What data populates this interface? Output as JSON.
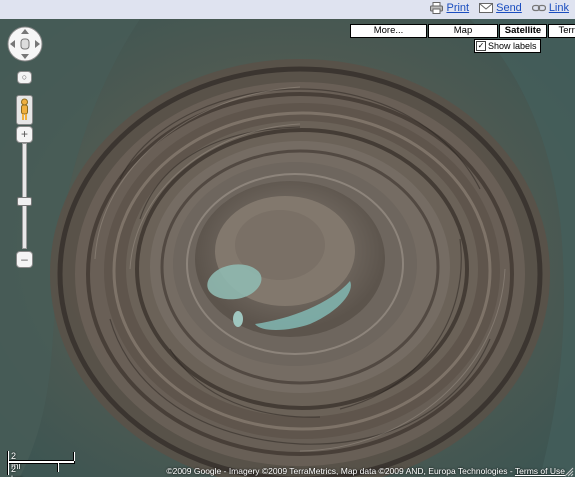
{
  "toolbar": {
    "print_label": "Print",
    "send_label": "Send",
    "link_label": "Link",
    "print_icon": "printer-icon",
    "send_icon": "envelope-icon",
    "link_icon": "chain-link-icon",
    "link_color": "#1a4dbf"
  },
  "map_types": {
    "more_label": "More...",
    "map_label": "Map",
    "satellite_label": "Satellite",
    "terrain_label": "Terrain",
    "selected": "Satellite",
    "show_labels_label": "Show labels",
    "show_labels_checked": true,
    "check_mark": "✓"
  },
  "navigation": {
    "pan_icon": "hand-pan-icon",
    "zoom_in_label": "+",
    "zoom_out_label": "–",
    "pegman_icon": "pegman-icon",
    "reset_icon": "reset-icon"
  },
  "scale": {
    "imperial_label": "2 mi",
    "metric_label": "2 km"
  },
  "attribution": {
    "text": "©2009 Google - Imagery ©2009 TerraMetrics, Map data ©2009 AND, Europa Technologies - ",
    "terms_label": "Terms of Use"
  }
}
